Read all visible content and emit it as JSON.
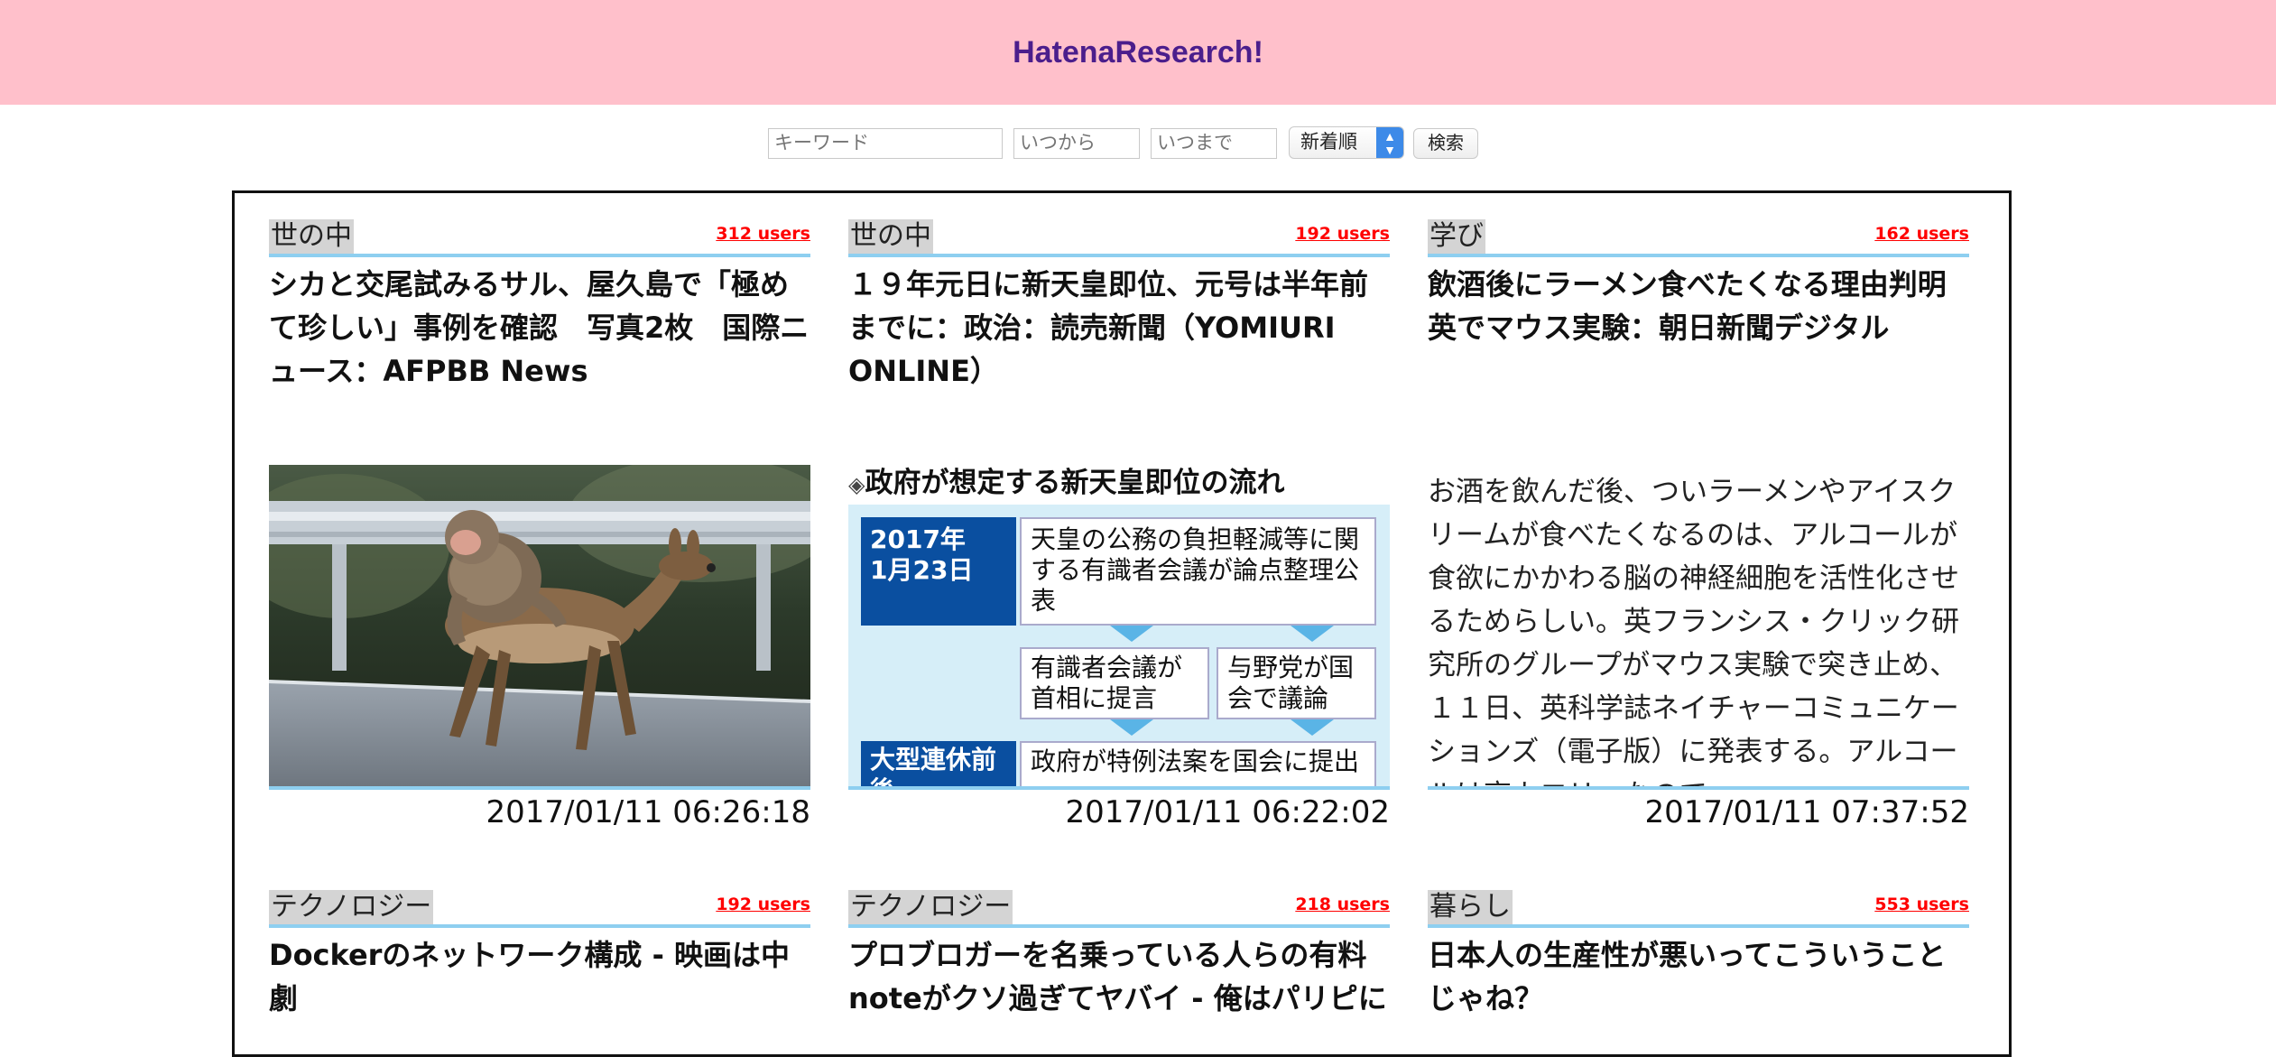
{
  "header": {
    "title": "HatenaResearch!"
  },
  "search": {
    "keyword_placeholder": "キーワード",
    "from_placeholder": "いつから",
    "to_placeholder": "いつまで",
    "sort_value": "新着順",
    "button_label": "検索"
  },
  "colors": {
    "header_bg": "#ffc0cb",
    "title_color": "#4b1e8c",
    "users_color": "#ff0000",
    "accent_line": "#8ecff0"
  },
  "articles": [
    {
      "category": "世の中",
      "users": "312 users",
      "title": "シカと交尾試みるサル、屋久島で「極めて珍しい」事例を確認　写真2枚　国際ニュース：AFPBB News",
      "media": "photo",
      "date": "2017/01/11 06:26:18"
    },
    {
      "category": "世の中",
      "users": "192 users",
      "title": "１９年元日に新天皇即位、元号は半年前までに：政治：読売新聞（YOMIURI ONLINE）",
      "media": "infographic",
      "infographic": {
        "heading": "政府が想定する新天皇即位の流れ",
        "step1_date": "2017年\n1月23日",
        "step1_text": "天皇の公務の負担軽減等に関する有識者会議が論点整理公表",
        "step2a": "有識者会議が首相に提言",
        "step2b": "与野党が国会で議論",
        "step3_date": "大型連休前後",
        "step3_text": "政府が特例法案を国会に提出"
      },
      "date": "2017/01/11 06:22:02"
    },
    {
      "category": "学び",
      "users": "162 users",
      "title": "飲酒後にラーメン食べたくなる理由判明　英でマウス実験：朝日新聞デジタル",
      "media": "text",
      "summary": "お酒を飲んだ後、ついラーメンやアイスクリームが食べたくなるのは、アルコールが食欲にかかわる脳の神経細胞を活性化させるためらしい。英フランシス・クリック研究所のグループがマウス実験で突き止め、１１日、英科学誌ネイチャーコミュニケーションズ（電子版）に発表する。アルコールは高カロリーなので",
      "date": "2017/01/11 07:37:52"
    },
    {
      "category": "テクノロジー",
      "users": "192 users",
      "title": "Dockerのネットワーク構成 - 映画は中劇"
    },
    {
      "category": "テクノロジー",
      "users": "218 users",
      "title": "プロブロガーを名乗っている人らの有料noteがクソ過ぎてヤバイ - 俺はパリピに"
    },
    {
      "category": "暮らし",
      "users": "553 users",
      "title": "日本人の生産性が悪いってこういうことじゃね？"
    }
  ]
}
